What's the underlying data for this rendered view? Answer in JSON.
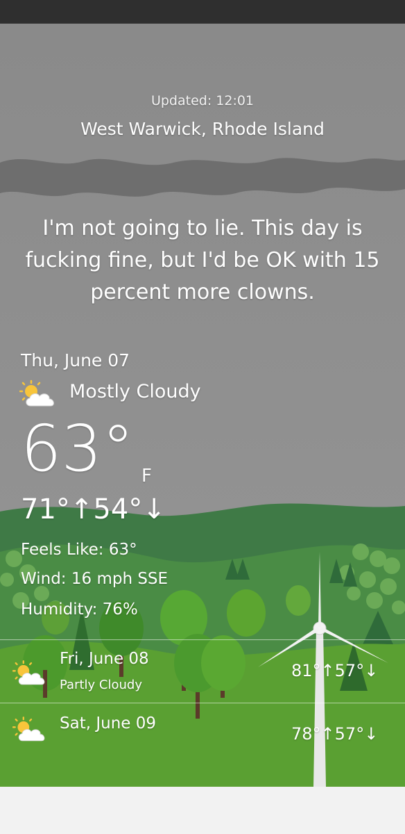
{
  "header": {
    "updated": "Updated: 12:01",
    "location": "West Warwick, Rhode Island"
  },
  "snark": "I'm not going to lie. This day is fucking fine, but I'd be OK with 15 percent more clowns.",
  "current": {
    "date": "Thu, June 07",
    "condition": "Mostly Cloudy",
    "condition_icon": "partly-sunny-cloud-icon",
    "temperature": "63°",
    "unit": "F",
    "hi_lo": "71°↑54°↓",
    "feels_like": "Feels Like: 63°",
    "wind": "Wind: 16 mph SSE",
    "humidity": "Humidity: 76%"
  },
  "forecast": [
    {
      "day": "Fri, June 08",
      "condition": "Partly Cloudy",
      "hi_lo": "81°↑57°↓",
      "icon": "partly-sunny-cloud-icon"
    },
    {
      "day": "Sat, June 09",
      "condition": "",
      "hi_lo": "78°↑57°↓",
      "icon": "partly-sunny-cloud-icon"
    }
  ],
  "colors": {
    "sky": "#8c8c8c",
    "storm_cloud": "#6f6f6f",
    "hills": "#4d8a3f",
    "grass": "#5aa032",
    "status_bar": "#2f2f2f"
  }
}
